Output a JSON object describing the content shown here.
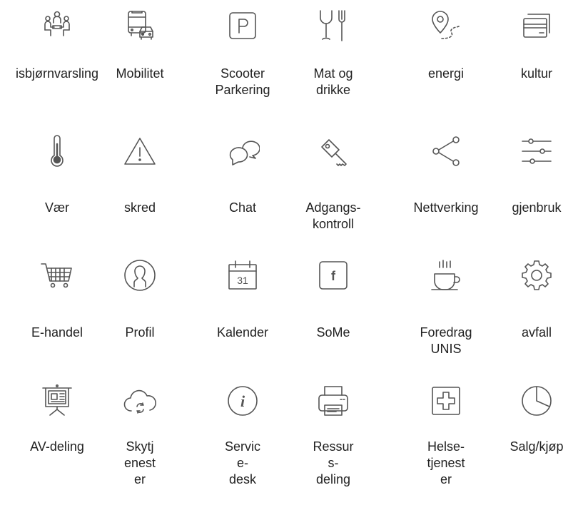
{
  "stroke_color": "#555555",
  "tiles": [
    {
      "label": "isbjørnvarsling",
      "icon": "meeting-people-icon",
      "name": "tile-isbjornvarsling"
    },
    {
      "label": "Mobilitet",
      "icon": "bus-car-icon",
      "name": "tile-mobilitet"
    },
    {
      "label": "Scooter\nParkering",
      "icon": "parking-icon",
      "name": "tile-scooter-parkering"
    },
    {
      "label": "Mat og\ndrikke",
      "icon": "glass-fork-icon",
      "name": "tile-mat-og-drikke"
    },
    {
      "label": "energi",
      "icon": "location-route-icon",
      "name": "tile-energi"
    },
    {
      "label": "kultur",
      "icon": "cards-icon",
      "name": "tile-kultur"
    },
    {
      "label": "Vær",
      "icon": "thermometer-icon",
      "name": "tile-vaer"
    },
    {
      "label": "skred",
      "icon": "warning-icon",
      "name": "tile-skred"
    },
    {
      "label": "Chat",
      "icon": "chat-bubbles-icon",
      "name": "tile-chat"
    },
    {
      "label": "Adgangs-\nkontroll",
      "icon": "key-icon",
      "name": "tile-adgangskontroll"
    },
    {
      "label": "Nettverking",
      "icon": "share-icon",
      "name": "tile-nettverking"
    },
    {
      "label": "gjenbruk",
      "icon": "sliders-icon",
      "name": "tile-gjenbruk"
    },
    {
      "label": "E-handel",
      "icon": "cart-icon",
      "name": "tile-e-handel"
    },
    {
      "label": "Profil",
      "icon": "profile-icon",
      "name": "tile-profil"
    },
    {
      "label": "Kalender",
      "icon": "calendar-icon",
      "calendar_day": "31",
      "name": "tile-kalender"
    },
    {
      "label": "SoMe",
      "icon": "facebook-icon",
      "facebook_letter": "f",
      "name": "tile-some"
    },
    {
      "label": "Foredrag\nUNIS",
      "icon": "coffee-cup-icon",
      "name": "tile-foredrag-unis"
    },
    {
      "label": "avfall",
      "icon": "gear-icon",
      "name": "tile-avfall"
    },
    {
      "label": "AV-deling",
      "icon": "presentation-icon",
      "name": "tile-av-deling"
    },
    {
      "label": "Skytj\nenest\ner",
      "icon": "cloud-sync-icon",
      "name": "tile-skytjenester"
    },
    {
      "label": "Servic\ne-\ndesk",
      "icon": "info-icon",
      "info_letter": "i",
      "name": "tile-servicedesk"
    },
    {
      "label": "Ressur\ns-\ndeling",
      "icon": "printer-icon",
      "name": "tile-ressursdeling"
    },
    {
      "label": "Helse-\ntjenest\ner",
      "icon": "medical-cross-icon",
      "name": "tile-helsetjenester"
    },
    {
      "label": "Salg/kjøp",
      "icon": "pie-chart-icon",
      "name": "tile-salg-kjop"
    }
  ]
}
